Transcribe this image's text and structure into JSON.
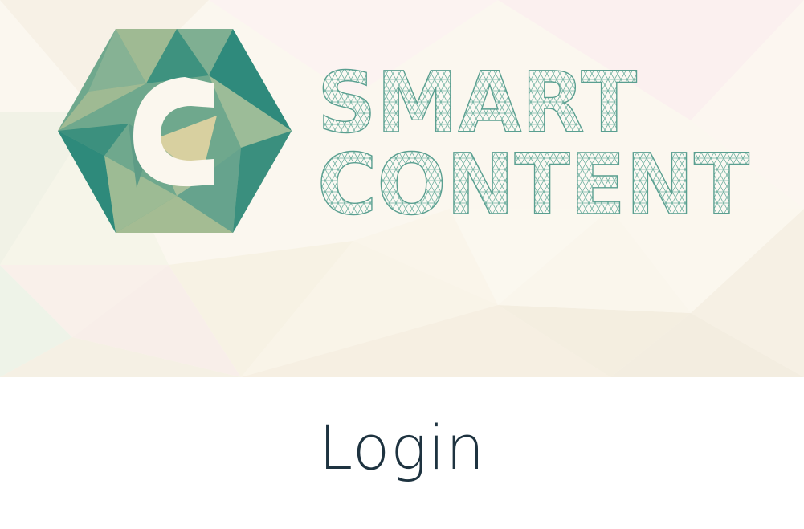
{
  "brand": {
    "logo_icon": "hexagon-c-logo-icon",
    "logo_letter": "C",
    "wordmark_line1": "SMART",
    "wordmark_line2": "CONTENT"
  },
  "main": {
    "title": "Login"
  },
  "colors": {
    "teal_dark": "#2e8c7e",
    "teal_mid": "#67a58e",
    "sage": "#9fba93",
    "title_text": "#1e3340",
    "background": "#ffffff"
  }
}
